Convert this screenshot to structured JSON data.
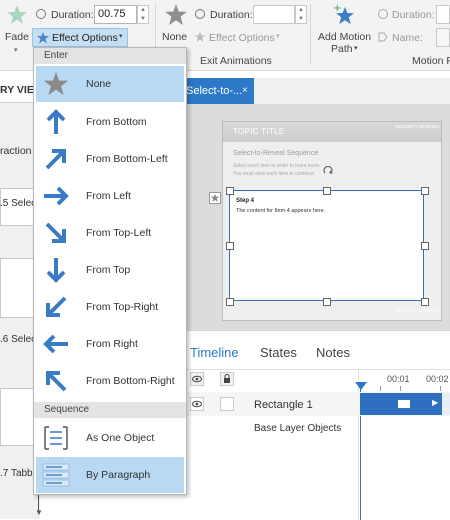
{
  "ribbon": {
    "fade_label": "Fade",
    "duration_label": "Duration:",
    "duration_value": "00.75",
    "effect_options_label": "Effect Options",
    "none_label": "None",
    "exit_duration_label": "Duration:",
    "exit_effect_options_label": "Effect Options",
    "exit_group_label": "Exit Animations",
    "add_motion_path_label": "Add Motion",
    "add_motion_path_label2": "Path",
    "motion_duration_label": "Duration:",
    "motion_name_label": "Name:",
    "motion_group_label": "Motion F"
  },
  "left_panel": {
    "view_label": "RY VIEW",
    "row1": "raction",
    "row2": ".5 Selec",
    "row3": ".6 Selec",
    "row4": ".7 Tabb"
  },
  "stage": {
    "tab_label": "Select-to-...",
    "slide_title": "TOPIC TITLE",
    "security_marking_top": "SECURITY MARKING",
    "sequence_heading": "Select-to-Reveal Sequence",
    "instruction1": "Select each item in order to learn more.",
    "instruction2": "You must view each item to continue.",
    "step_title": "Step 4",
    "step_text": "The content for Item 4 appears here.",
    "security_marking_bottom": "SECURITY MARKING"
  },
  "timeline": {
    "tabs": [
      "Timeline",
      "States",
      "Notes"
    ],
    "ticks": [
      "00:01",
      "00:02"
    ],
    "row_label": "Rectangle 1",
    "base_layer_label": "Base Layer Objects"
  },
  "dropdown": {
    "enter_header": "Enter",
    "enter_items": [
      "None",
      "From Bottom",
      "From Bottom-Left",
      "From Left",
      "From Top-Left",
      "From Top",
      "From Top-Right",
      "From Right",
      "From Bottom-Right"
    ],
    "sequence_header": "Sequence",
    "sequence_items": [
      "As One Object",
      "By Paragraph"
    ]
  },
  "colors": {
    "accent": "#2e78c8",
    "selected": "#b9d9f2",
    "arrow": "#3a7bc8"
  }
}
